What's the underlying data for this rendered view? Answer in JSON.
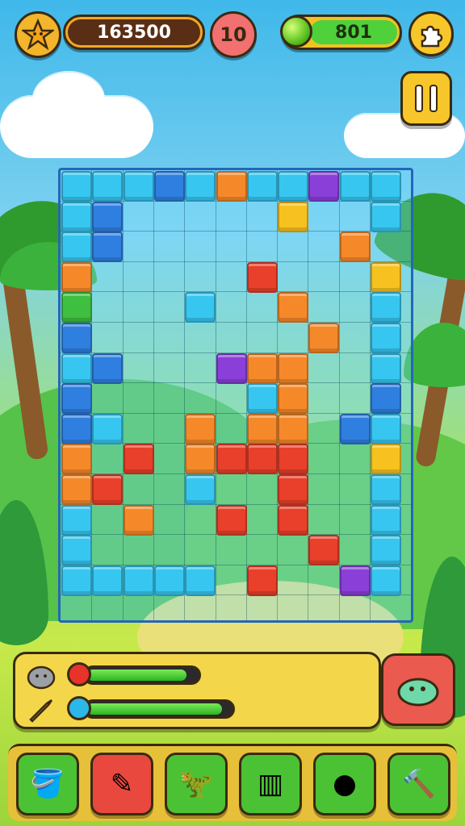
{
  "hud": {
    "score": "163500",
    "moves": "10",
    "gems": "801",
    "profile_icon": "star-badge-icon",
    "map_icon": "puzzle-piece-icon",
    "pause_icon": "pause-icon"
  },
  "colors": {
    "cyan": "#37c6f0",
    "blue": "#2f7fe0",
    "purple": "#8a3fd8",
    "orange": "#f5892a",
    "red": "#e8402a",
    "yellow": "#f7c21f",
    "green": "#3fbf3f",
    "board_border": "#2566b8"
  },
  "status": {
    "top_bar_level": 0.88,
    "bottom_bar_level": 0.92,
    "top_icon": "rock-golem-icon",
    "bottom_icon": "rocket-icon",
    "action_icon": "rock-creature-icon"
  },
  "toolbar": {
    "items": [
      {
        "icon": "bucket-icon",
        "color": "#4bc234"
      },
      {
        "icon": "pencil-icon",
        "color": "#e8483e"
      },
      {
        "icon": "dino-icon",
        "color": "#4bc234"
      },
      {
        "icon": "cage-icon",
        "color": "#4bc234"
      },
      {
        "icon": "cookie-icon",
        "color": "#4bc234"
      },
      {
        "icon": "hammer-icon",
        "color": "#4bc234"
      }
    ]
  }
}
